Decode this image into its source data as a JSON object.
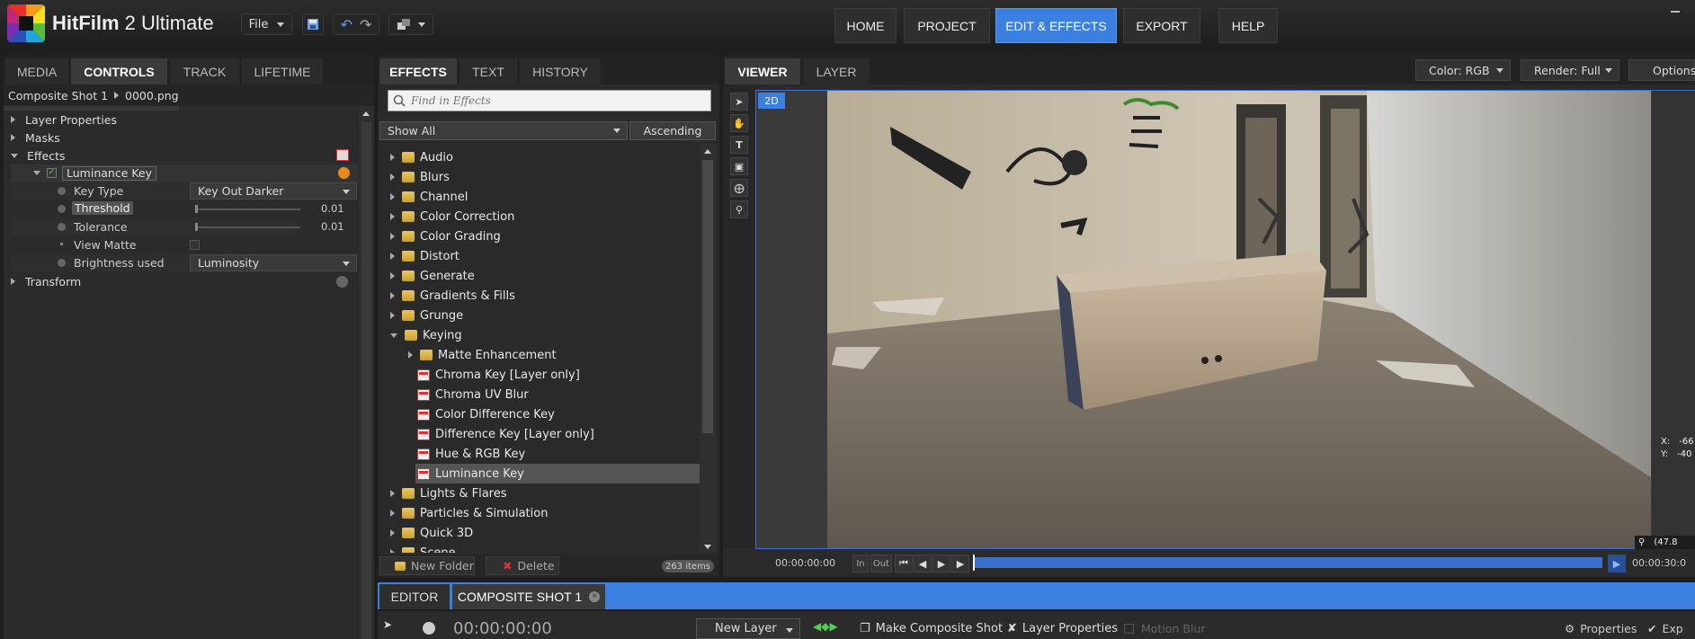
{
  "app": {
    "name_bold": "HitFilm",
    "name_rest": " 2 Ultimate"
  },
  "toolbar": {
    "file_label": "File"
  },
  "nav": {
    "home": "HOME",
    "project": "PROJECT",
    "edit_effects": "EDIT & EFFECTS",
    "export": "EXPORT",
    "help": "HELP"
  },
  "left_panel": {
    "tabs": [
      "MEDIA",
      "CONTROLS",
      "TRACK",
      "LIFETIME"
    ],
    "breadcrumb": {
      "shot": "Composite Shot 1",
      "file": "0000.png"
    },
    "tree": {
      "layer_properties": "Layer Properties",
      "masks": "Masks",
      "effects": "Effects",
      "effect_name": "Luminance Key",
      "transform": "Transform"
    },
    "controls": [
      {
        "label": "Key Type",
        "value": "Key Out Darker"
      },
      {
        "label": "Threshold",
        "value": "0.01"
      },
      {
        "label": "Tolerance",
        "value": "0.01"
      },
      {
        "label": "View Matte",
        "value": ""
      },
      {
        "label": "Brightness used",
        "value": "Luminosity"
      }
    ],
    "threshold_level": 0.01,
    "tolerance_level": 0.01
  },
  "effects_panel": {
    "tabs": [
      "EFFECTS",
      "TEXT",
      "HISTORY"
    ],
    "search_placeholder": "Find in Effects",
    "filter": "Show All",
    "sort": "Ascending",
    "items": [
      {
        "label": "Audio",
        "kind": "folder",
        "level": 0,
        "open": false
      },
      {
        "label": "Blurs",
        "kind": "folder",
        "level": 0,
        "open": false
      },
      {
        "label": "Channel",
        "kind": "folder",
        "level": 0,
        "open": false
      },
      {
        "label": "Color Correction",
        "kind": "folder",
        "level": 0,
        "open": false
      },
      {
        "label": "Color Grading",
        "kind": "folder",
        "level": 0,
        "open": false
      },
      {
        "label": "Distort",
        "kind": "folder",
        "level": 0,
        "open": false
      },
      {
        "label": "Generate",
        "kind": "folder",
        "level": 0,
        "open": false
      },
      {
        "label": "Gradients & Fills",
        "kind": "folder",
        "level": 0,
        "open": false
      },
      {
        "label": "Grunge",
        "kind": "folder",
        "level": 0,
        "open": false
      },
      {
        "label": "Keying",
        "kind": "folder",
        "level": 0,
        "open": true
      },
      {
        "label": "Matte Enhancement",
        "kind": "folder",
        "level": 1,
        "open": false
      },
      {
        "label": "Chroma Key [Layer only]",
        "kind": "effect",
        "level": 1
      },
      {
        "label": "Chroma UV Blur",
        "kind": "effect",
        "level": 1
      },
      {
        "label": "Color Difference Key",
        "kind": "effect",
        "level": 1
      },
      {
        "label": "Difference Key [Layer only]",
        "kind": "effect",
        "level": 1
      },
      {
        "label": "Hue & RGB Key",
        "kind": "effect",
        "level": 1
      },
      {
        "label": "Luminance Key",
        "kind": "effect",
        "level": 1,
        "selected": true
      },
      {
        "label": "Lights & Flares",
        "kind": "folder",
        "level": 0,
        "open": false
      },
      {
        "label": "Particles & Simulation",
        "kind": "folder",
        "level": 0,
        "open": false
      },
      {
        "label": "Quick 3D",
        "kind": "folder",
        "level": 0,
        "open": false
      },
      {
        "label": "Scene",
        "kind": "folder",
        "level": 0,
        "open": false
      }
    ],
    "new_folder": "New Folder",
    "delete": "Delete",
    "count": "263 items"
  },
  "viewer": {
    "tabs": [
      "VIEWER",
      "LAYER"
    ],
    "color_mode": "Color: RGB",
    "render_mode": "Render: Full",
    "options": "Options",
    "mode_badge": "2D",
    "coord_x_label": "X:",
    "coord_x": "-66",
    "coord_y_label": "Y:",
    "coord_y": "-40",
    "zoom": "(47.8",
    "timecode_start": "00:00:00:00",
    "in_label": "In",
    "out_label": "Out",
    "timecode_end": "00:00:30:0"
  },
  "editor": {
    "tabs": [
      "EDITOR",
      "COMPOSITE SHOT 1"
    ],
    "timecode": "00:00:00:00",
    "new_layer": "New Layer",
    "make_composite": "Make Composite Shot",
    "layer_properties": "Layer Properties",
    "motion_blur": "Motion Blur",
    "properties": "Properties",
    "export_short": "Exp"
  }
}
